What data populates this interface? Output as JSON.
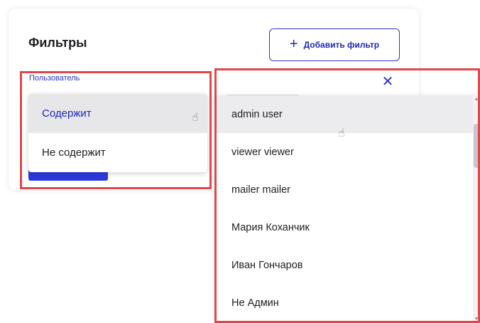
{
  "filters": {
    "title": "Фильтры",
    "add_button_label": "Добавить фильтр",
    "add_button_icon": "plus-icon",
    "field_label": "Пользователь"
  },
  "operator_dropdown": {
    "items": [
      {
        "label": "Содержит",
        "selected": true
      },
      {
        "label": "Не содержит",
        "selected": false
      }
    ]
  },
  "user_dropdown": {
    "close_icon": "close-icon",
    "items": [
      {
        "label": "admin user",
        "hovered": true
      },
      {
        "label": "viewer viewer",
        "hovered": false
      },
      {
        "label": "mailer mailer",
        "hovered": false
      },
      {
        "label": "Мария Коханчик",
        "hovered": false
      },
      {
        "label": "Иван Гончаров",
        "hovered": false
      },
      {
        "label": "Не Админ",
        "hovered": false
      }
    ]
  },
  "colors": {
    "accent": "#2a35c9",
    "highlight_border": "#e0464b",
    "selected_background": "#e7e7e9"
  }
}
